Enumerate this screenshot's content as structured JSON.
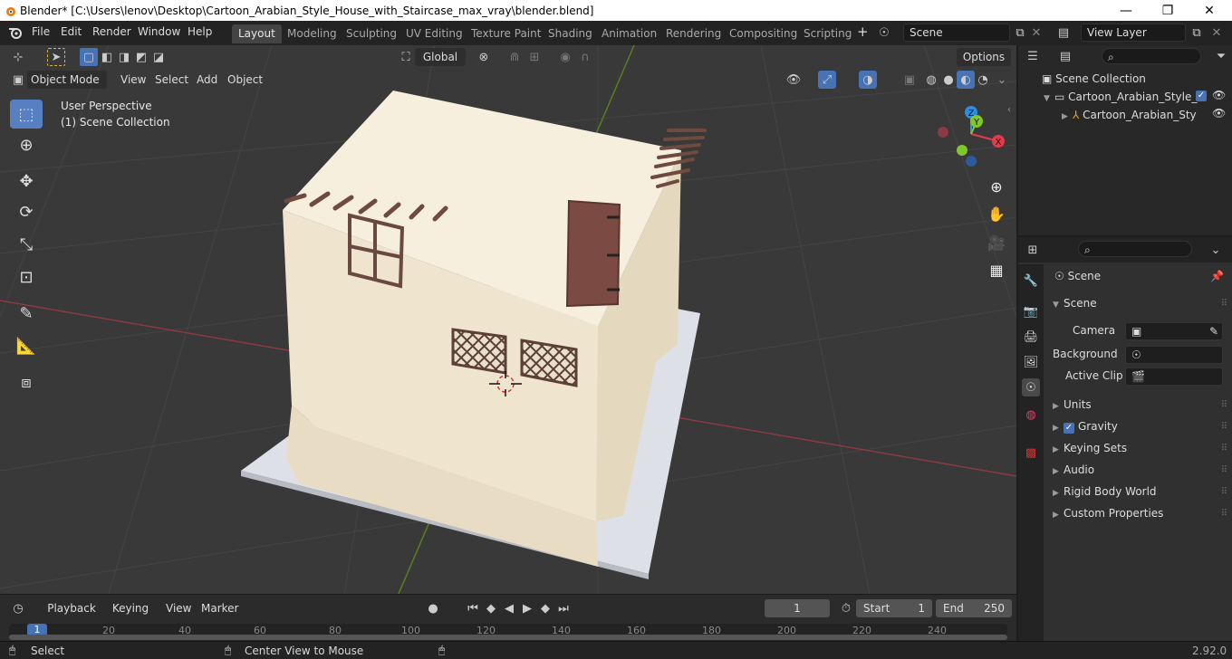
{
  "window": {
    "title": "Blender* [C:\\Users\\lenov\\Desktop\\Cartoon_Arabian_Style_House_with_Staircase_max_vray\\blender.blend]",
    "minimize": "—",
    "maximize": "❐",
    "close": "✕"
  },
  "menu": [
    "File",
    "Edit",
    "Render",
    "Window",
    "Help"
  ],
  "workspaces": [
    "Layout",
    "Modeling",
    "Sculpting",
    "UV Editing",
    "Texture Paint",
    "Shading",
    "Animation",
    "Rendering",
    "Compositing",
    "Scripting"
  ],
  "active_workspace": "Layout",
  "scene_field": "Scene",
  "view_layer_field": "View Layer",
  "viewport": {
    "transform_orientation": "Global",
    "options_label": "Options",
    "mode": "Object Mode",
    "header_menus": [
      "View",
      "Select",
      "Add",
      "Object"
    ],
    "perspective": "User Perspective",
    "collection": "(1) Scene Collection",
    "gizmo": {
      "z": "Z",
      "y": "Y",
      "x": "X"
    }
  },
  "timeline": {
    "menus": [
      "Playback",
      "Keying",
      "View",
      "Marker"
    ],
    "current_frame": "1",
    "start_label": "Start",
    "start": "1",
    "end_label": "End",
    "end": "250",
    "ticks": [
      "1",
      "20",
      "40",
      "60",
      "80",
      "100",
      "120",
      "140",
      "160",
      "180",
      "200",
      "220",
      "240"
    ]
  },
  "status": {
    "select": "Select",
    "center": "Center View to Mouse",
    "version": "2.92.0"
  },
  "outliner": {
    "root": "Scene Collection",
    "items": [
      "Cartoon_Arabian_Style_H",
      "Cartoon_Arabian_Sty"
    ]
  },
  "properties": {
    "header": "Scene",
    "panel": "Scene",
    "fields": [
      {
        "label": "Camera"
      },
      {
        "label": "Background ..."
      },
      {
        "label": "Active Clip"
      }
    ],
    "sections": [
      "Units",
      "Gravity",
      "Keying Sets",
      "Audio",
      "Rigid Body World",
      "Custom Properties"
    ]
  },
  "colors": {
    "accent": "#4772b3",
    "active_tool": "#5680c2",
    "x_axis": "#e23b4e",
    "y_axis": "#7fc72a",
    "z_axis": "#2c8ee0"
  }
}
